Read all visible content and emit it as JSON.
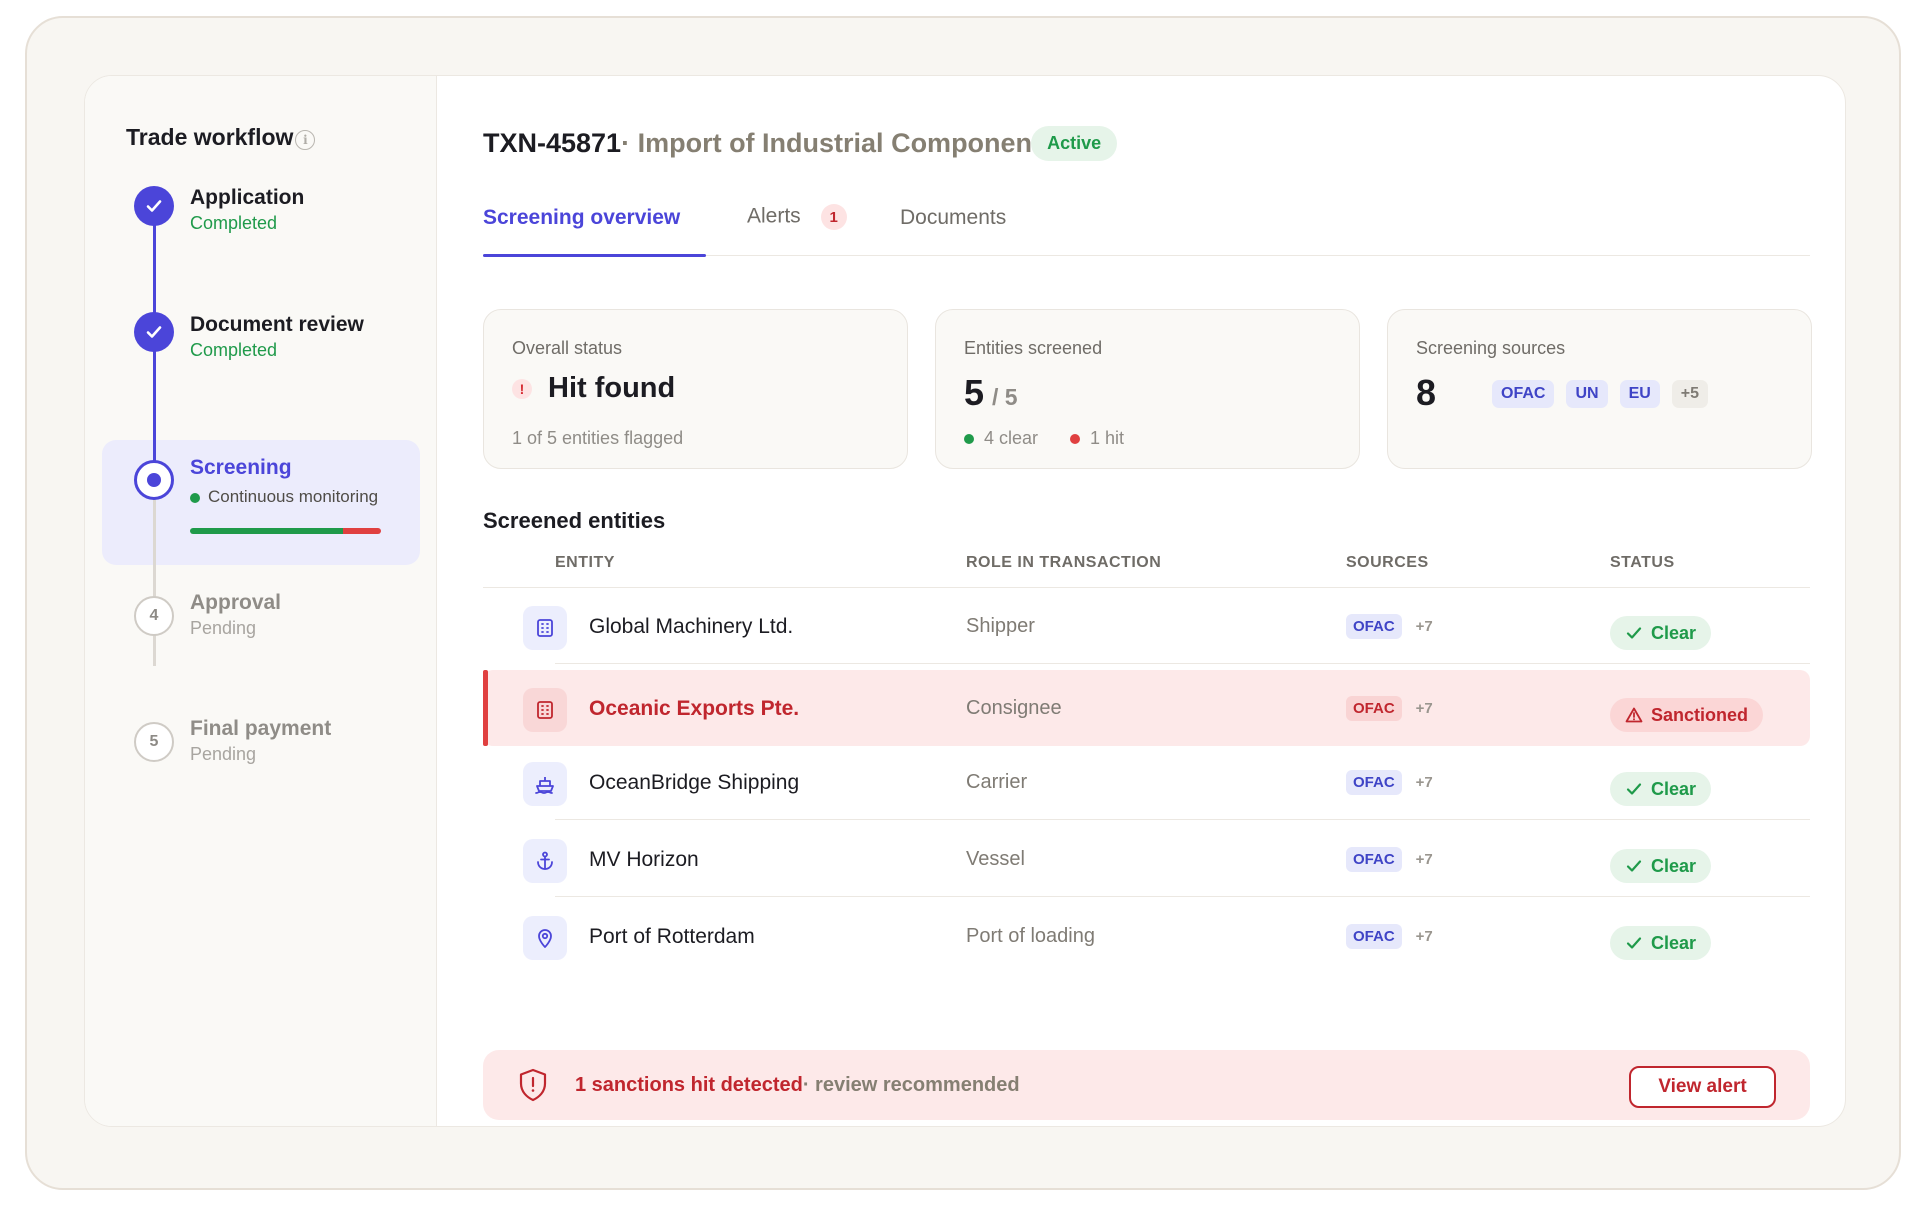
{
  "sidebar": {
    "title": "Trade workflow",
    "steps": [
      {
        "label": "Application",
        "status": "Completed"
      },
      {
        "label": "Document review",
        "status": "Completed"
      },
      {
        "label": "Screening",
        "status": "Continuous monitoring",
        "progress_clear_fraction": 0.8
      },
      {
        "label": "Approval",
        "status": "Pending",
        "number": "4"
      },
      {
        "label": "Final payment",
        "status": "Pending",
        "number": "5"
      }
    ]
  },
  "header": {
    "txn_id": "TXN-45871",
    "txn_name": "· Import of Industrial Components",
    "status": "Active"
  },
  "tabs": [
    {
      "label": "Screening overview"
    },
    {
      "label": "Alerts",
      "badge": "1"
    },
    {
      "label": "Documents"
    }
  ],
  "stats": {
    "overall": {
      "caption": "Overall status",
      "value": "Hit found",
      "icon": "!",
      "footer": "1 of 5 entities flagged"
    },
    "entities": {
      "caption": "Entities screened",
      "value": "5",
      "of": "/ 5",
      "clear": "4 clear",
      "hit": "1 hit"
    },
    "sources": {
      "caption": "Screening sources",
      "value": "8",
      "pills": [
        "OFAC",
        "UN",
        "EU",
        "+5"
      ]
    }
  },
  "entities": {
    "title": "Screened entities",
    "columns": [
      "ENTITY",
      "ROLE IN TRANSACTION",
      "SOURCES",
      "STATUS"
    ],
    "rows": [
      {
        "name": "Global Machinery Ltd.",
        "role": "Shipper",
        "source": "OFAC",
        "more": "+7",
        "status": "Clear",
        "icon": "building-icon"
      },
      {
        "name": "Oceanic Exports Pte.",
        "role": "Consignee",
        "source": "OFAC",
        "more": "+7",
        "status": "Sanctioned",
        "icon": "building-icon"
      },
      {
        "name": "OceanBridge Shipping",
        "role": "Carrier",
        "source": "OFAC",
        "more": "+7",
        "status": "Clear",
        "icon": "ship-icon"
      },
      {
        "name": "MV Horizon",
        "role": "Vessel",
        "source": "OFAC",
        "more": "+7",
        "status": "Clear",
        "icon": "anchor-icon"
      },
      {
        "name": "Port of Rotterdam",
        "role": "Port of loading",
        "source": "OFAC",
        "more": "+7",
        "status": "Clear",
        "icon": "location-pin-icon"
      }
    ]
  },
  "alert": {
    "strong": "1 sanctions hit detected",
    "rest": "· review recommended",
    "button": "View alert"
  },
  "colors": {
    "accent": "#4b45d9",
    "success": "#1f9a4a",
    "danger": "#c0262e",
    "background": "#f8f6f2"
  }
}
